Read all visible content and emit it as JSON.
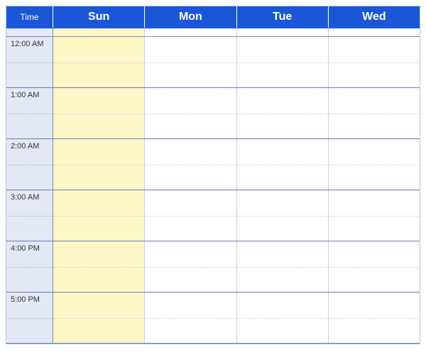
{
  "header": {
    "time_label": "Time",
    "days": [
      "Sun",
      "Mon",
      "Tue",
      "Wed"
    ]
  },
  "hours": [
    "12:00 AM",
    "1:00 AM",
    "2:00 AM",
    "3:00 AM",
    "4:00 PM",
    "5:00 PM"
  ],
  "highlight_day_index": 0
}
